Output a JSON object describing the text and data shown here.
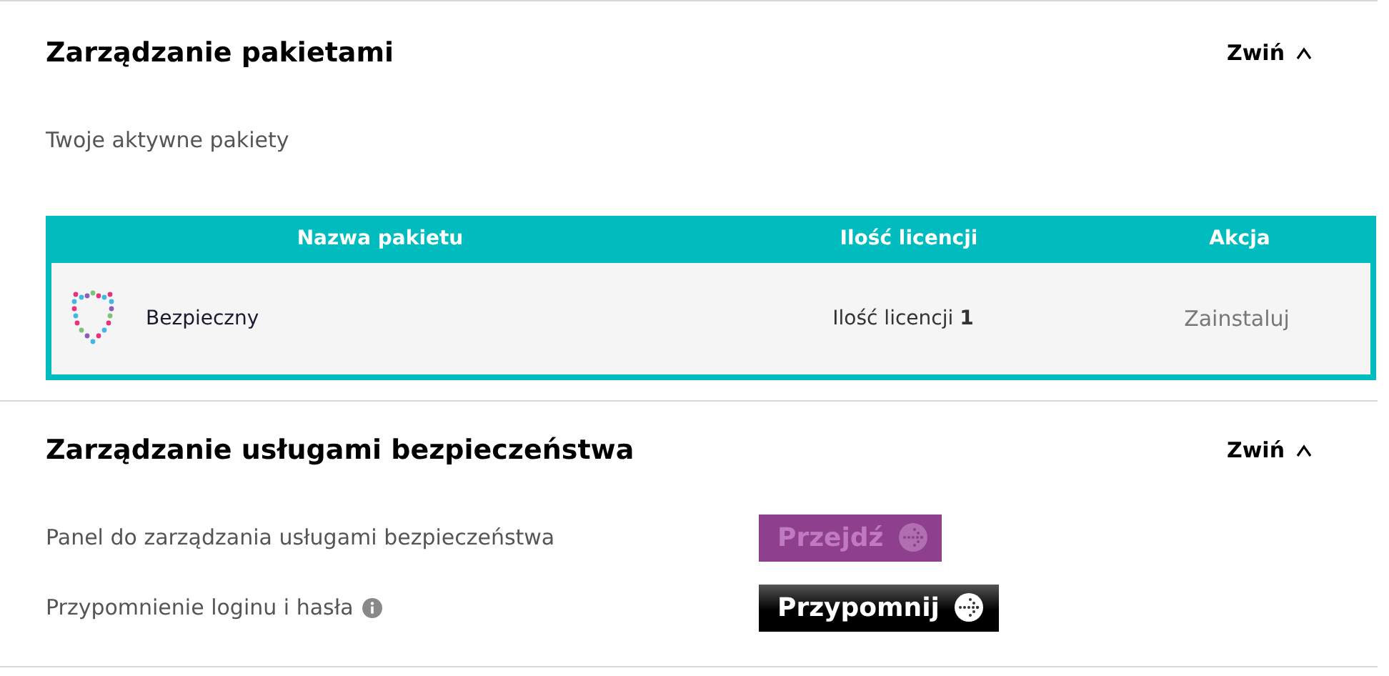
{
  "sections": [
    {
      "title": "Zarządzanie pakietami",
      "toggle": "Zwiń",
      "expanded": true,
      "kind": "packages",
      "subtitle": "Twoje aktywne pakiety",
      "table": {
        "columns": [
          "Nazwa pakietu",
          "Ilość licencji",
          "Akcja"
        ],
        "rows": [
          {
            "name": "Bezpieczny",
            "licenses_label": "Ilość licencji",
            "licenses": "1",
            "action": "Zainstaluj"
          }
        ]
      }
    },
    {
      "title": "Zarządzanie usługami bezpieczeństwa",
      "toggle": "Zwiń",
      "expanded": true,
      "kind": "services",
      "items": [
        {
          "label": "Panel do zarządzania usługami bezpieczeństwa",
          "info": false,
          "button": "Przejdź",
          "disabled": true
        },
        {
          "label": "Przypomnienie loginu i hasła",
          "info": true,
          "button": "Przypomnij",
          "disabled": false
        }
      ]
    }
  ]
}
